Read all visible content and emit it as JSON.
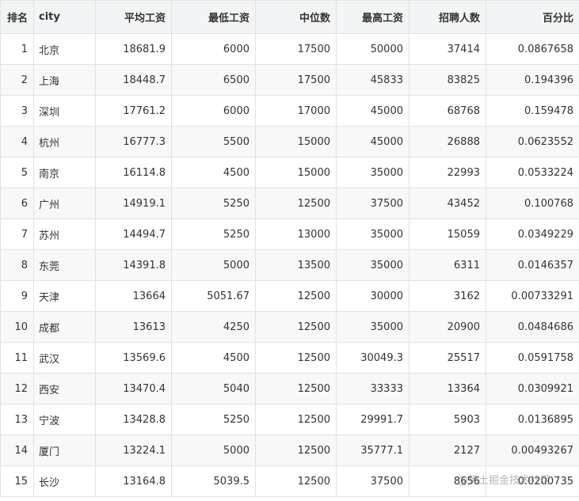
{
  "table": {
    "headers": [
      "排名",
      "city",
      "平均工资",
      "最低工资",
      "中位数",
      "最高工资",
      "招聘人数",
      "百分比"
    ],
    "rows": [
      [
        "1",
        "北京",
        "18681.9",
        "6000",
        "17500",
        "50000",
        "37414",
        "0.0867658"
      ],
      [
        "2",
        "上海",
        "18448.7",
        "6500",
        "17500",
        "45833",
        "83825",
        "0.194396"
      ],
      [
        "3",
        "深圳",
        "17761.2",
        "6000",
        "17000",
        "45000",
        "68768",
        "0.159478"
      ],
      [
        "4",
        "杭州",
        "16777.3",
        "5500",
        "15000",
        "45000",
        "26888",
        "0.0623552"
      ],
      [
        "5",
        "南京",
        "16114.8",
        "4500",
        "15000",
        "35000",
        "22993",
        "0.0533224"
      ],
      [
        "6",
        "广州",
        "14919.1",
        "5250",
        "12500",
        "37500",
        "43452",
        "0.100768"
      ],
      [
        "7",
        "苏州",
        "14494.7",
        "5250",
        "13000",
        "35000",
        "15059",
        "0.0349229"
      ],
      [
        "8",
        "东莞",
        "14391.8",
        "5000",
        "13500",
        "35000",
        "6311",
        "0.0146357"
      ],
      [
        "9",
        "天津",
        "13664",
        "5051.67",
        "12500",
        "30000",
        "3162",
        "0.00733291"
      ],
      [
        "10",
        "成都",
        "13613",
        "4250",
        "12500",
        "35000",
        "20900",
        "0.0484686"
      ],
      [
        "11",
        "武汉",
        "13569.6",
        "4500",
        "12500",
        "30049.3",
        "25517",
        "0.0591758"
      ],
      [
        "12",
        "西安",
        "13470.4",
        "5040",
        "12500",
        "33333",
        "13364",
        "0.0309921"
      ],
      [
        "13",
        "宁波",
        "13428.8",
        "5250",
        "12500",
        "29991.7",
        "5903",
        "0.0136895"
      ],
      [
        "14",
        "厦门",
        "13224.1",
        "5000",
        "12500",
        "35777.1",
        "2127",
        "0.00493267"
      ],
      [
        "15",
        "长沙",
        "13164.8",
        "5039.5",
        "12500",
        "37500",
        "8656",
        "0.0200735"
      ]
    ]
  },
  "watermark": {
    "text": "@稀土掘金技术社区"
  }
}
